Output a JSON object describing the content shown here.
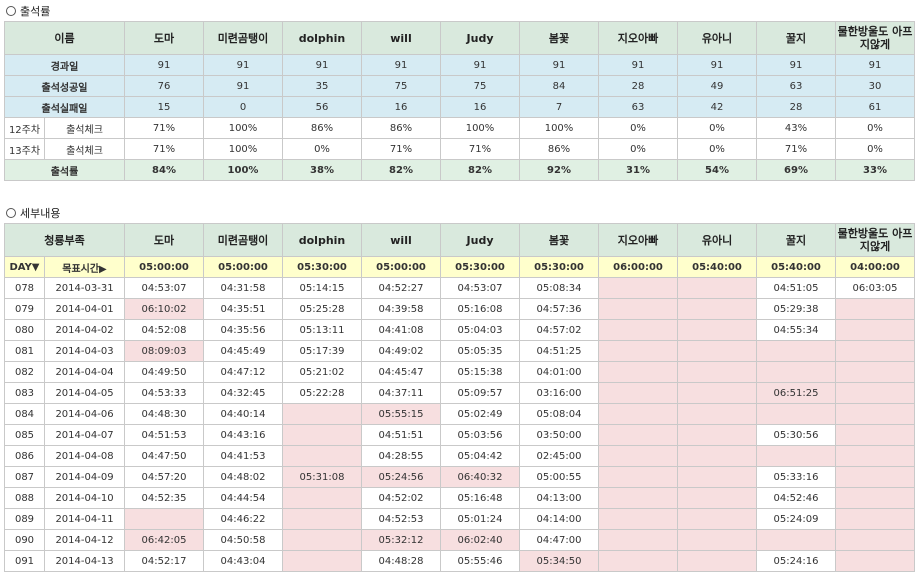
{
  "sections": {
    "rate_title": "출석률",
    "detail_title": "세부내용"
  },
  "members": [
    "도마",
    "미련곰탱이",
    "dolphin",
    "will",
    "Judy",
    "봄꽃",
    "지오아빠",
    "유아니",
    "꿀지",
    "물한방울도 아프지않게"
  ],
  "rate_table": {
    "name_header": "이름",
    "stats": [
      {
        "label": "경과일",
        "values": [
          "91",
          "91",
          "91",
          "91",
          "91",
          "91",
          "91",
          "91",
          "91",
          "91"
        ]
      },
      {
        "label": "출석성공일",
        "values": [
          "76",
          "91",
          "35",
          "75",
          "75",
          "84",
          "28",
          "49",
          "63",
          "30"
        ]
      },
      {
        "label": "출석실패일",
        "values": [
          "15",
          "0",
          "56",
          "16",
          "16",
          "7",
          "63",
          "42",
          "28",
          "61"
        ]
      }
    ],
    "weeks": [
      {
        "week": "12주차",
        "label": "출석체크",
        "values": [
          "71%",
          "100%",
          "86%",
          "86%",
          "100%",
          "100%",
          "0%",
          "0%",
          "43%",
          "0%"
        ]
      },
      {
        "week": "13주차",
        "label": "출석체크",
        "values": [
          "71%",
          "100%",
          "0%",
          "71%",
          "71%",
          "86%",
          "0%",
          "0%",
          "71%",
          "0%"
        ]
      }
    ],
    "total": {
      "label": "출석률",
      "values": [
        "84%",
        "100%",
        "38%",
        "82%",
        "82%",
        "92%",
        "31%",
        "54%",
        "69%",
        "33%"
      ]
    }
  },
  "detail_table": {
    "team_header": "청룡부족",
    "day_header": "DAY▼",
    "target_header": "목표시간▶",
    "targets": [
      "05:00:00",
      "05:00:00",
      "05:30:00",
      "05:00:00",
      "05:30:00",
      "05:30:00",
      "06:00:00",
      "05:40:00",
      "05:40:00",
      "04:00:00"
    ],
    "rows": [
      {
        "day": "078",
        "date": "2014-03-31",
        "times": [
          "04:53:07",
          "04:31:58",
          "05:14:15",
          "04:52:27",
          "04:53:07",
          "05:08:34",
          "",
          "",
          "04:51:05",
          "06:03:05"
        ]
      },
      {
        "day": "079",
        "date": "2014-04-01",
        "times": [
          "06:10:02",
          "04:35:51",
          "05:25:28",
          "04:39:58",
          "05:16:08",
          "04:57:36",
          "",
          "",
          "05:29:38",
          ""
        ]
      },
      {
        "day": "080",
        "date": "2014-04-02",
        "times": [
          "04:52:08",
          "04:35:56",
          "05:13:11",
          "04:41:08",
          "05:04:03",
          "04:57:02",
          "",
          "",
          "04:55:34",
          ""
        ]
      },
      {
        "day": "081",
        "date": "2014-04-03",
        "times": [
          "08:09:03",
          "04:45:49",
          "05:17:39",
          "04:49:02",
          "05:05:35",
          "04:51:25",
          "",
          "",
          "",
          ""
        ]
      },
      {
        "day": "082",
        "date": "2014-04-04",
        "times": [
          "04:49:50",
          "04:47:12",
          "05:21:02",
          "04:45:47",
          "05:15:38",
          "04:01:00",
          "",
          "",
          "",
          ""
        ]
      },
      {
        "day": "083",
        "date": "2014-04-05",
        "times": [
          "04:53:33",
          "04:32:45",
          "05:22:28",
          "04:37:11",
          "05:09:57",
          "03:16:00",
          "",
          "",
          "06:51:25",
          ""
        ]
      },
      {
        "day": "084",
        "date": "2014-04-06",
        "times": [
          "04:48:30",
          "04:40:14",
          "",
          "05:55:15",
          "05:02:49",
          "05:08:04",
          "",
          "",
          "",
          ""
        ]
      },
      {
        "day": "085",
        "date": "2014-04-07",
        "times": [
          "04:51:53",
          "04:43:16",
          "",
          "04:51:51",
          "05:03:56",
          "03:50:00",
          "",
          "",
          "05:30:56",
          ""
        ]
      },
      {
        "day": "086",
        "date": "2014-04-08",
        "times": [
          "04:47:50",
          "04:41:53",
          "",
          "04:28:55",
          "05:04:42",
          "02:45:00",
          "",
          "",
          "",
          ""
        ]
      },
      {
        "day": "087",
        "date": "2014-04-09",
        "times": [
          "04:57:20",
          "04:48:02",
          "05:31:08",
          "05:24:56",
          "06:40:32",
          "05:00:55",
          "",
          "",
          "05:33:16",
          ""
        ]
      },
      {
        "day": "088",
        "date": "2014-04-10",
        "times": [
          "04:52:35",
          "04:44:54",
          "",
          "04:52:02",
          "05:16:48",
          "04:13:00",
          "",
          "",
          "04:52:46",
          ""
        ]
      },
      {
        "day": "089",
        "date": "2014-04-11",
        "times": [
          "",
          "04:46:22",
          "",
          "04:52:53",
          "05:01:24",
          "04:14:00",
          "",
          "",
          "05:24:09",
          ""
        ]
      },
      {
        "day": "090",
        "date": "2014-04-12",
        "times": [
          "06:42:05",
          "04:50:58",
          "",
          "05:32:12",
          "06:02:40",
          "04:47:00",
          "",
          "",
          "",
          ""
        ]
      },
      {
        "day": "091",
        "date": "2014-04-13",
        "times": [
          "04:52:17",
          "04:43:04",
          "",
          "04:48:28",
          "05:55:46",
          "05:34:50",
          "",
          "",
          "05:24:16",
          ""
        ]
      }
    ],
    "misses": [
      [
        0,
        6
      ],
      [
        0,
        7
      ],
      [
        1,
        0
      ],
      [
        1,
        6
      ],
      [
        1,
        7
      ],
      [
        1,
        9
      ],
      [
        2,
        6
      ],
      [
        2,
        7
      ],
      [
        2,
        9
      ],
      [
        3,
        0
      ],
      [
        3,
        6
      ],
      [
        3,
        7
      ],
      [
        3,
        8
      ],
      [
        3,
        9
      ],
      [
        4,
        6
      ],
      [
        4,
        7
      ],
      [
        4,
        8
      ],
      [
        4,
        9
      ],
      [
        5,
        6
      ],
      [
        5,
        7
      ],
      [
        5,
        8
      ],
      [
        5,
        9
      ],
      [
        6,
        2
      ],
      [
        6,
        3
      ],
      [
        6,
        6
      ],
      [
        6,
        7
      ],
      [
        6,
        8
      ],
      [
        6,
        9
      ],
      [
        7,
        2
      ],
      [
        7,
        6
      ],
      [
        7,
        7
      ],
      [
        7,
        9
      ],
      [
        8,
        2
      ],
      [
        8,
        6
      ],
      [
        8,
        7
      ],
      [
        8,
        8
      ],
      [
        8,
        9
      ],
      [
        9,
        2
      ],
      [
        9,
        3
      ],
      [
        9,
        4
      ],
      [
        9,
        6
      ],
      [
        9,
        7
      ],
      [
        9,
        9
      ],
      [
        10,
        2
      ],
      [
        10,
        6
      ],
      [
        10,
        7
      ],
      [
        10,
        9
      ],
      [
        11,
        0
      ],
      [
        11,
        2
      ],
      [
        11,
        6
      ],
      [
        11,
        7
      ],
      [
        11,
        9
      ],
      [
        12,
        0
      ],
      [
        12,
        2
      ],
      [
        12,
        3
      ],
      [
        12,
        4
      ],
      [
        12,
        6
      ],
      [
        12,
        7
      ],
      [
        12,
        8
      ],
      [
        12,
        9
      ],
      [
        13,
        2
      ],
      [
        13,
        5
      ],
      [
        13,
        6
      ],
      [
        13,
        7
      ],
      [
        13,
        9
      ]
    ]
  }
}
